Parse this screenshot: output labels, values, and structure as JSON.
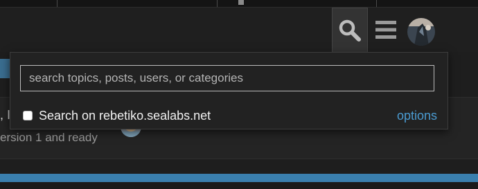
{
  "header": {
    "search_icon": "search-icon",
    "menu_icon": "hamburger-menu-icon",
    "avatar_icon": "user-avatar"
  },
  "background": {
    "topic_title_fragment": ", I",
    "topic_excerpt_fragment": "ersion 1 and ready"
  },
  "search_menu": {
    "placeholder": "search topics, posts, users, or categories",
    "value": "",
    "context_label": "Search on rebetiko.sealabs.net",
    "context_checked": false,
    "options_label": "options"
  },
  "colors": {
    "accent_link": "#4a9bd1",
    "bottom_bar": "#3a7fae",
    "background": "#1c1c1c"
  }
}
